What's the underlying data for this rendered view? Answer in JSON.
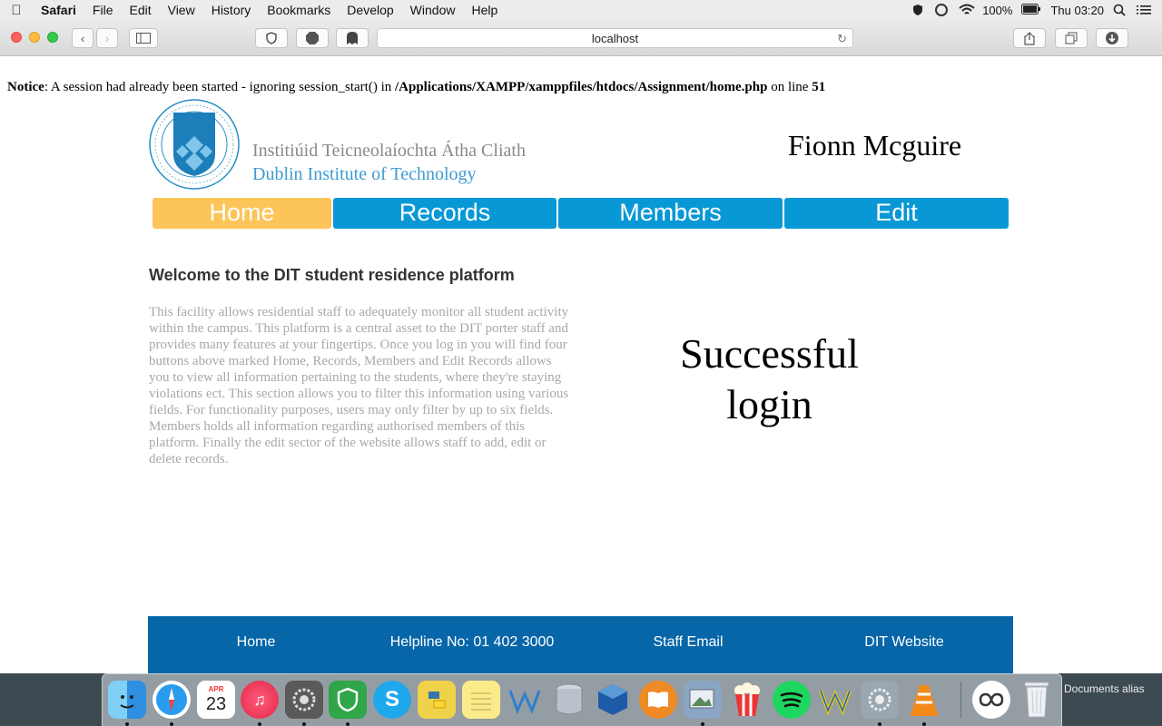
{
  "menubar": {
    "app": "Safari",
    "items": [
      "File",
      "Edit",
      "View",
      "History",
      "Bookmarks",
      "Develop",
      "Window",
      "Help"
    ],
    "battery": "100%",
    "clock": "Thu 03:20"
  },
  "toolbar": {
    "url": "localhost",
    "extensions": [
      "shield-icon",
      "adblock-icon",
      "ghostery-icon"
    ]
  },
  "notice": {
    "label": "Notice",
    "text": ": A session had already been started - ignoring session_start() in ",
    "path": "/Applications/XAMPP/xamppfiles/htdocs/Assignment/home.php",
    "mid": " on line ",
    "line": "51"
  },
  "header": {
    "logo_ga": "Institiúid Teicneolaíochta Átha Cliath",
    "logo_en": "Dublin Institute of Technology",
    "username": "Fionn Mcguire"
  },
  "nav": {
    "items": [
      {
        "label": "Home",
        "active": true
      },
      {
        "label": "Records",
        "active": false
      },
      {
        "label": "Members",
        "active": false
      },
      {
        "label": "Edit",
        "active": false
      }
    ]
  },
  "main": {
    "heading": "Welcome to the DIT student residence platform",
    "description": "This facility allows residential staff to adequately monitor all student activity within the campus. This platform is a central asset to the DIT porter staff and provides many features at your fingertips. Once you log in you will find four buttons above marked Home, Records, Members and Edit Records allows you to view all information pertaining to the students, where they're staying violations ect. This section allows you to filter this information using various fields. For functionality purposes, users may only filter by up to six fields. Members holds all information regarding authorised members of this platform. Finally the edit sector of the website allows staff to add, edit or delete records.",
    "success": "Successful login"
  },
  "footer": {
    "links": [
      "Home",
      "Helpline No: 01 402 3000",
      "Staff Email",
      "DIT Website"
    ]
  },
  "dock": {
    "apps": [
      "finder-icon",
      "safari-icon",
      "calendar-icon",
      "itunes-icon",
      "system-preferences-dark-icon",
      "vpn-shield-icon",
      "skype-icon",
      "python-launcher-icon",
      "notes-icon",
      "wunderlist-icon",
      "database-icon",
      "virtualbox-icon",
      "ibooks-icon",
      "preview-icon",
      "popcorn-time-icon",
      "spotify-icon",
      "wireshark-icon",
      "system-preferences-icon",
      "vlc-icon",
      "network-icon",
      "trash-icon"
    ],
    "calendar_month": "APR",
    "calendar_day": "23",
    "alias_label": "Documents alias"
  },
  "colors": {
    "nav_active": "#fdc459",
    "nav_default": "#0898d5",
    "footer": "#0766a8",
    "logo_blue": "#3d9bd1"
  }
}
